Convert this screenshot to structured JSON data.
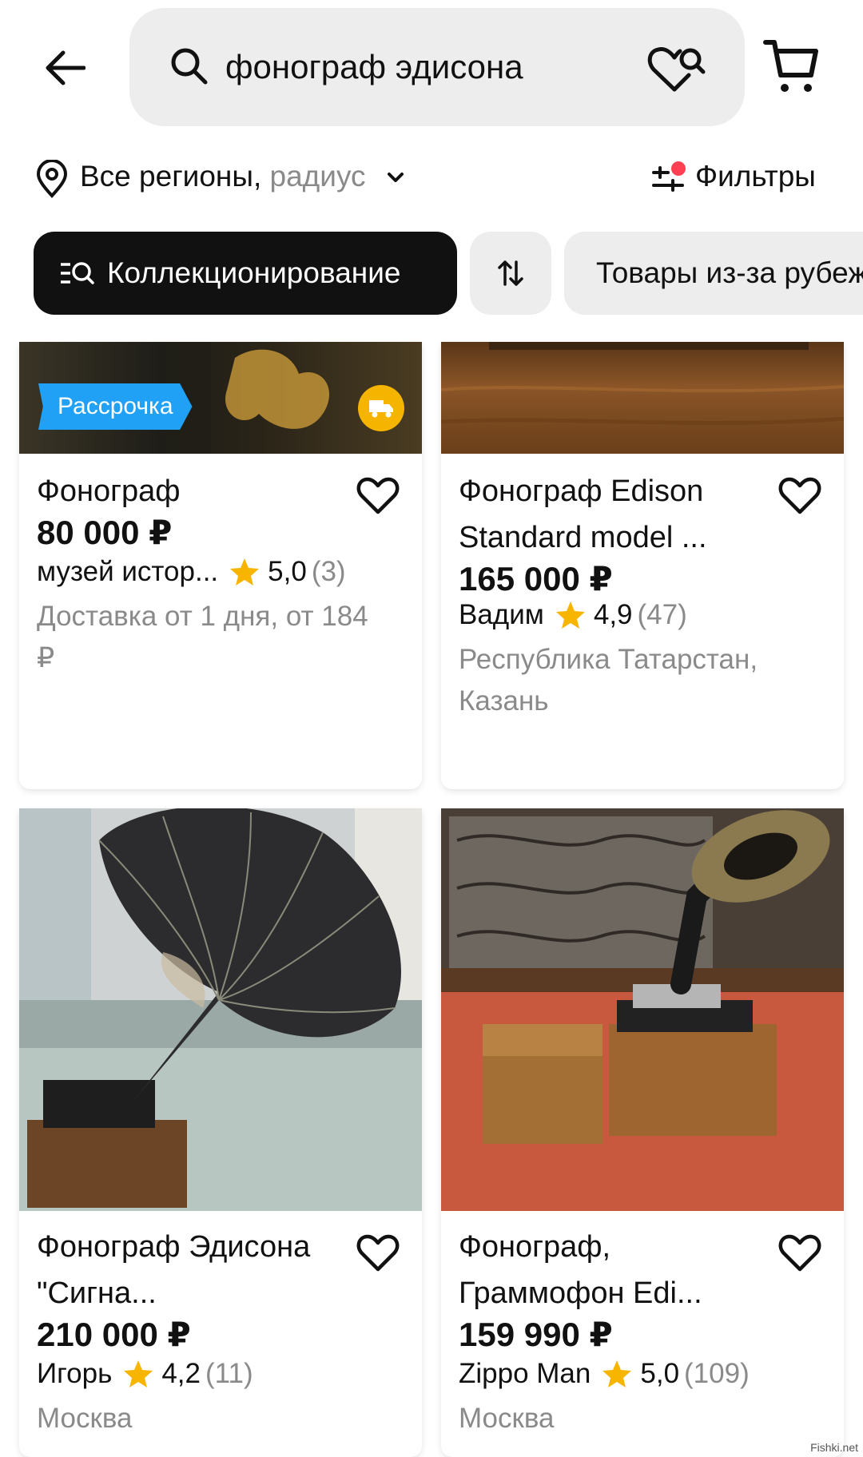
{
  "header": {
    "search_query": "фонограф эдисона"
  },
  "location": {
    "regions": "Все регионы,",
    "radius": "радиус",
    "filters_label": "Фильтры"
  },
  "chips": {
    "category": "Коллекционирование",
    "abroad": "Товары из-за рубеж"
  },
  "products": [
    {
      "title": "Фонограф",
      "price": "80 000 ₽",
      "seller": "музей истор...",
      "rating": "5,0",
      "reviews": "(3)",
      "location": "Доставка от 1 дня, от 184 ₽",
      "badge": "Рассрочка"
    },
    {
      "title": "Фонограф Edison Standard model ...",
      "price": "165 000 ₽",
      "seller": "Вадим",
      "rating": "4,9",
      "reviews": "(47)",
      "location": "Республика Татарстан, Казань"
    },
    {
      "title": "Фонограф Эдисона \"Сигна...",
      "price": "210 000 ₽",
      "seller": "Игорь",
      "rating": "4,2",
      "reviews": "(11)",
      "location": "Москва"
    },
    {
      "title": "Фонограф, Граммофон Edi...",
      "price": "159 990 ₽",
      "seller": "Zippo Man",
      "rating": "5,0",
      "reviews": "(109)",
      "location": "Москва"
    }
  ],
  "watermark": "Fishki.net",
  "colors": {
    "accent_badge": "#21a1f5",
    "star": "#f7b500",
    "filter_dot": "#ff4053",
    "chip_dark": "#111111",
    "chip_light": "#ededed"
  }
}
